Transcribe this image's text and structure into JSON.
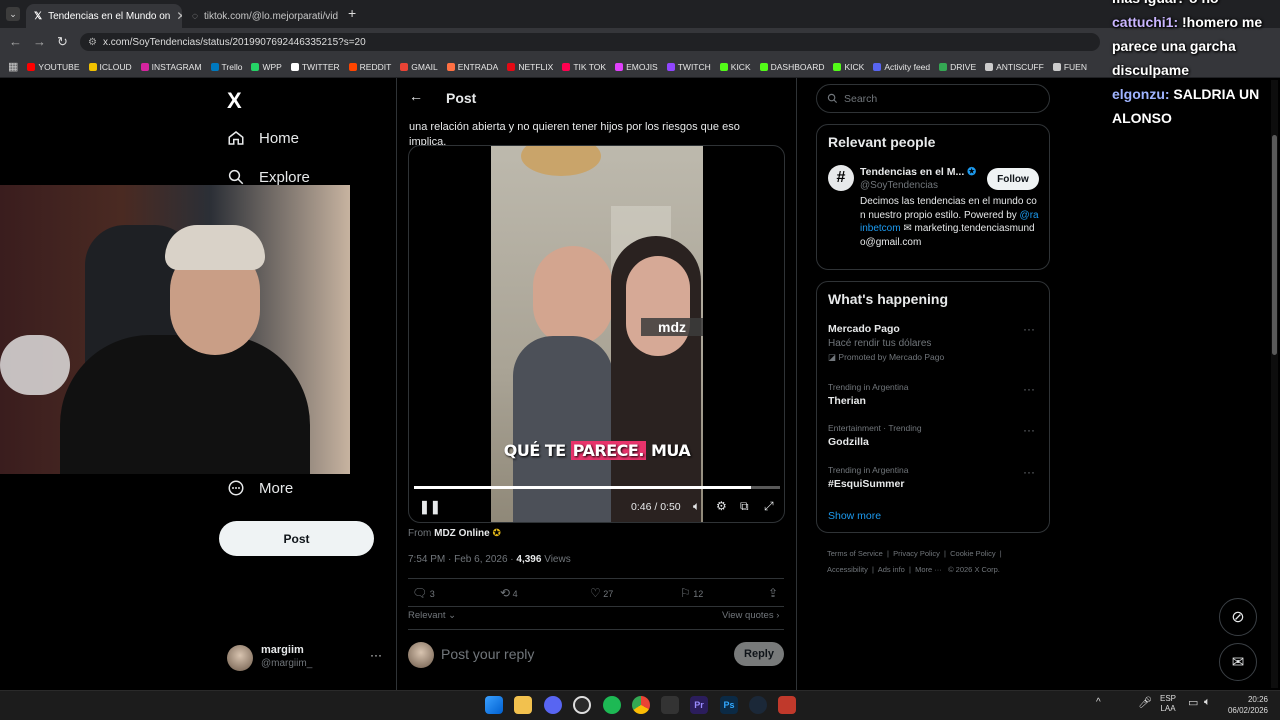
{
  "browser": {
    "tabs": [
      {
        "title": "Tendencias en el Mundo on",
        "active": true
      },
      {
        "title": "tiktok.com/@lo.mejorparati/vid",
        "active": false
      }
    ],
    "url": "x.com/SoyTendencias/status/2019907692446335215?s=20",
    "bookmarks": [
      "YOUTUBE",
      "ICLOUD",
      "INSTAGRAM",
      "Trello",
      "WPP",
      "TWITTER",
      "REDDIT",
      "GMAIL",
      "ENTRADA",
      "NETFLIX",
      "TIK TOK",
      "EMOJIS",
      "TWITCH",
      "KICK",
      "DASHBOARD",
      "KICK",
      "Activity feed",
      "DRIVE",
      "ANTISCUFF",
      "FUEN"
    ],
    "bookmark_colors": [
      "#ff0000",
      "#f2c200",
      "#d6249f",
      "#0079bf",
      "#25d366",
      "#ffffff",
      "#ff4500",
      "#ea4335",
      "#ff7043",
      "#e50914",
      "#ff0050",
      "#e040fb",
      "#9146ff",
      "#53fc18",
      "#53fc18",
      "#53fc18",
      "#5865f2",
      "#34a853",
      "#cccccc",
      "#cccccc"
    ]
  },
  "sidebar": {
    "logo": "X",
    "items": [
      {
        "label": "Home",
        "icon": "home-icon"
      },
      {
        "label": "Explore",
        "icon": "search-icon"
      },
      {
        "label": "More",
        "icon": "more-circle-icon"
      }
    ],
    "post_button": "Post",
    "account": {
      "name": "margiim",
      "handle": "@margiim_"
    }
  },
  "post": {
    "header": "Post",
    "text_fragment": "una relación abierta y no quieren tener hijos por los riesgos que eso implica.",
    "video": {
      "overlay_logo": "mdz",
      "caption_before": "QUÉ TE ",
      "caption_highlight": "PARECE.",
      "caption_after": " MUA",
      "time": "0:46 / 0:50",
      "progress": 0.92
    },
    "from_label": "From",
    "from_source": "MDZ Online",
    "timestamp": "7:54 PM · Feb 6, 2026 ·",
    "views_count": "4,396",
    "views_label": "Views",
    "replies": "3",
    "reposts": "4",
    "likes": "27",
    "bookmarks": "12",
    "relevant": "Relevant",
    "view_quotes": "View quotes",
    "reply_placeholder": "Post your reply",
    "reply_button": "Reply"
  },
  "right": {
    "search_placeholder": "Search",
    "relevant_people_title": "Relevant people",
    "person": {
      "name": "Tendencias en el M...",
      "handle": "@SoyTendencias",
      "follow": "Follow",
      "bio_1": "Decimos las tendencias en el mundo con nuestro propio estilo. Powered by",
      "bio_link": "@rainbetcom",
      "bio_2": "marketing.tendenciasmundo@gmail.com"
    },
    "happening_title": "What's happening",
    "trends": [
      {
        "meta": "",
        "title": "Mercado Pago",
        "sub": "Hacé rendir tus dólares",
        "promo": "Promoted by Mercado Pago"
      },
      {
        "meta": "Trending in Argentina",
        "title": "Therian"
      },
      {
        "meta": "Entertainment · Trending",
        "title": "Godzilla"
      },
      {
        "meta": "Trending in Argentina",
        "title": "#EsquiSummer"
      }
    ],
    "show_more": "Show more",
    "footer": [
      "Terms of Service",
      "Privacy Policy",
      "Cookie Policy",
      "Accessibility",
      "Ads info",
      "More ···",
      "© 2026 X Corp."
    ]
  },
  "chat": {
    "line0": "más igual? o no",
    "user1": "cattuchi1:",
    "msg1": " !homero me parece una garcha disculpame",
    "user2": "elgonzu:",
    "msg2": " SALDRIA UN ALONSO"
  },
  "taskbar": {
    "lang": "ESP",
    "lang2": "LAA",
    "time": "20:26",
    "date": "06/02/2026"
  }
}
